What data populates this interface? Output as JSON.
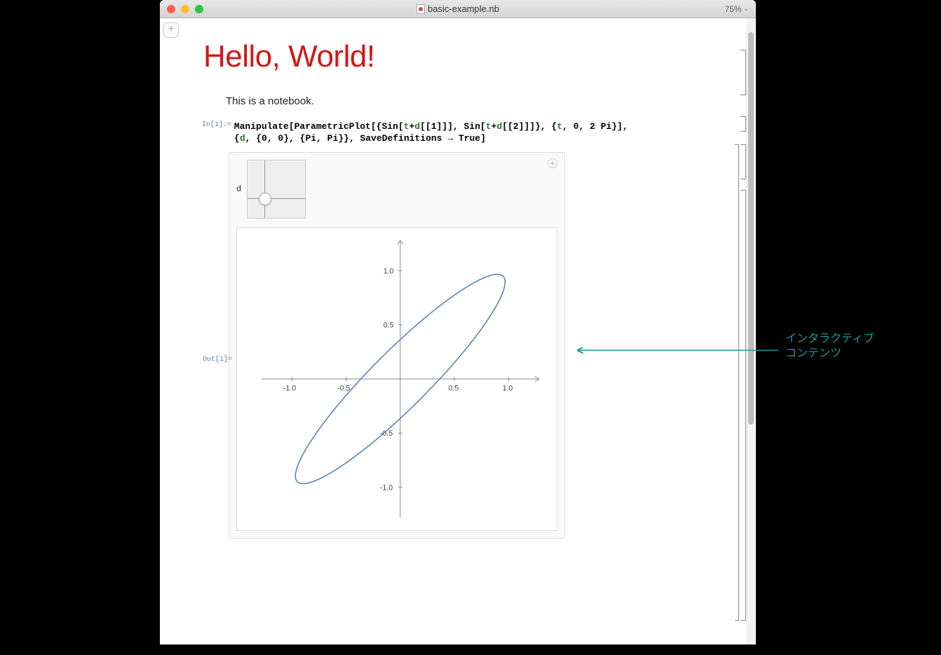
{
  "window": {
    "title": "basic-example.nb",
    "zoom": "75%"
  },
  "notebook": {
    "heading": "Hello, World!",
    "text": "This is a notebook.",
    "in_label": "In[1]:=",
    "out_label": "Out[1]=",
    "code_line1_pre": "Manipulate[ParametricPlot[{Sin[",
    "code_line1_mid1": "+",
    "code_line1_mid2": "[[1]]], Sin[",
    "code_line1_mid3": "+",
    "code_line1_mid4": "[[2]]]}, {",
    "code_line1_post": ", 0, 2 Pi}],",
    "code_tok_t": "t",
    "code_tok_d": "d",
    "code_line2": "{",
    "code_line2_b": ", {0, 0}, {Pi, Pi}}, SaveDefinitions → True]",
    "slider_label": "d"
  },
  "annotation": {
    "line1": "インタラクティブ",
    "line2": "コンテンツ"
  },
  "chart_data": {
    "type": "line",
    "title": "",
    "xlabel": "",
    "ylabel": "",
    "xlim": [
      -1.2,
      1.2
    ],
    "ylim": [
      -1.2,
      1.2
    ],
    "xticks": [
      -1.0,
      -0.5,
      0.5,
      1.0
    ],
    "yticks": [
      -1.0,
      -0.5,
      0.5,
      1.0
    ],
    "series": [
      {
        "name": "ellipse",
        "description": "Parametric curve {Sin[t+d1], Sin[t+d2]} forming a narrow diagonal ellipse from approx (-1,-1) to (1,1)",
        "color": "#5b7eb5",
        "x": [
          -0.14,
          0.04,
          0.23,
          0.42,
          0.59,
          0.74,
          0.87,
          0.95,
          1.0,
          1.0,
          0.96,
          0.88,
          0.76,
          0.61,
          0.44,
          0.26,
          0.07,
          -0.12,
          -0.3,
          -0.48,
          -0.64,
          -0.78,
          -0.89,
          -0.97,
          -1.0,
          -0.99,
          -0.94,
          -0.85,
          -0.72,
          -0.56,
          -0.39,
          -0.2,
          -0.01,
          0.14,
          -0.14
        ],
        "y": [
          0.14,
          0.32,
          0.5,
          0.66,
          0.8,
          0.9,
          0.97,
          1.0,
          0.98,
          0.92,
          0.82,
          0.69,
          0.53,
          0.36,
          0.17,
          -0.02,
          -0.21,
          -0.39,
          -0.56,
          -0.72,
          -0.84,
          -0.93,
          -0.99,
          -1.0,
          -0.97,
          -0.89,
          -0.78,
          -0.64,
          -0.47,
          -0.29,
          -0.1,
          0.09,
          0.28,
          0.14,
          0.14
        ]
      }
    ]
  }
}
